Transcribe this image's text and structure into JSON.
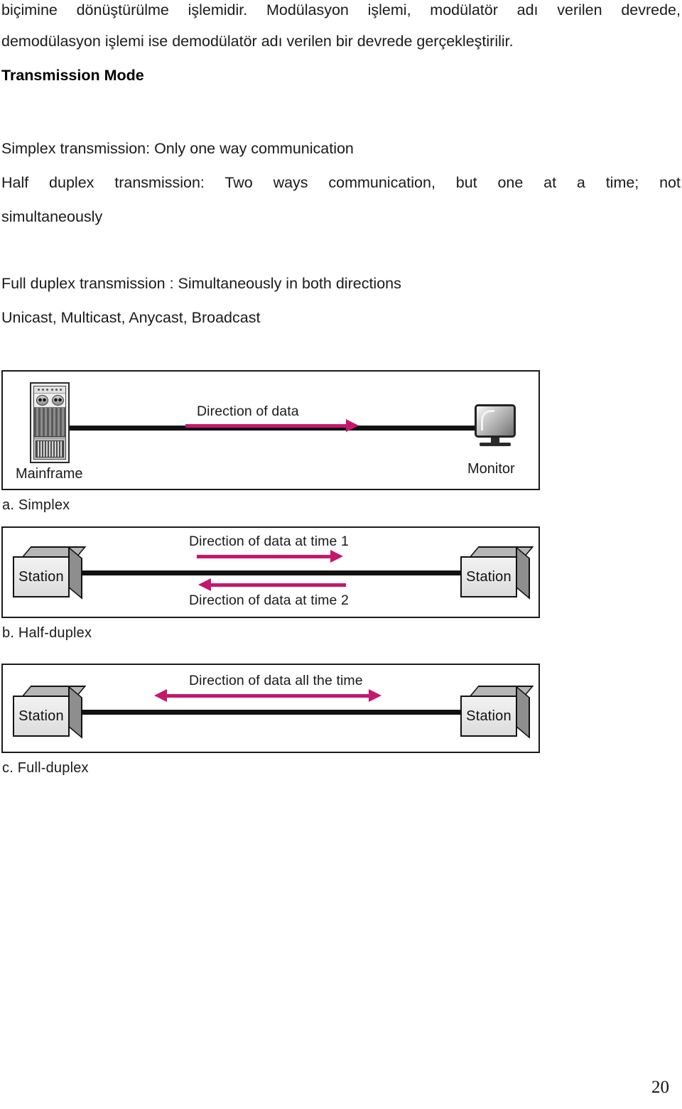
{
  "document": {
    "page_number": "20",
    "accent_color": "#c5176e",
    "line_color": "#111111"
  },
  "text": {
    "intro_paragraph_line1": "biçimine dönüştürülme işlemidir. Modülasyon işlemi, modülatör adı verilen devrede,",
    "intro_paragraph_line2": "demodülasyon işlemi ise demodülatör adı verilen bir devrede gerçekleştirilir.",
    "heading": "Transmission Mode",
    "simplex_line": "Simplex transmission: Only one way communication",
    "half_duplex_line1": "Half duplex transmission: Two ways communication, but one at a time; not",
    "half_duplex_line2": "simultaneously",
    "full_duplex_line": "Full duplex transmission : Simultaneously in both directions",
    "cast_types_line": "Unicast, Multicast, Anycast, Broadcast"
  },
  "figure": {
    "simplex": {
      "caption": "a. Simplex",
      "arrow_label": "Direction of data",
      "left_device_label": "Mainframe",
      "right_device_label": "Monitor",
      "left_device_icon": "mainframe-icon",
      "right_device_icon": "monitor-icon"
    },
    "half_duplex": {
      "caption": "b. Half-duplex",
      "arrow_label_top": "Direction of data at time 1",
      "arrow_label_bottom": "Direction of data at time 2",
      "left_device_label": "Station",
      "right_device_label": "Station"
    },
    "full_duplex": {
      "caption": "c. Full-duplex",
      "arrow_label": "Direction of data all the time",
      "left_device_label": "Station",
      "right_device_label": "Station"
    }
  }
}
